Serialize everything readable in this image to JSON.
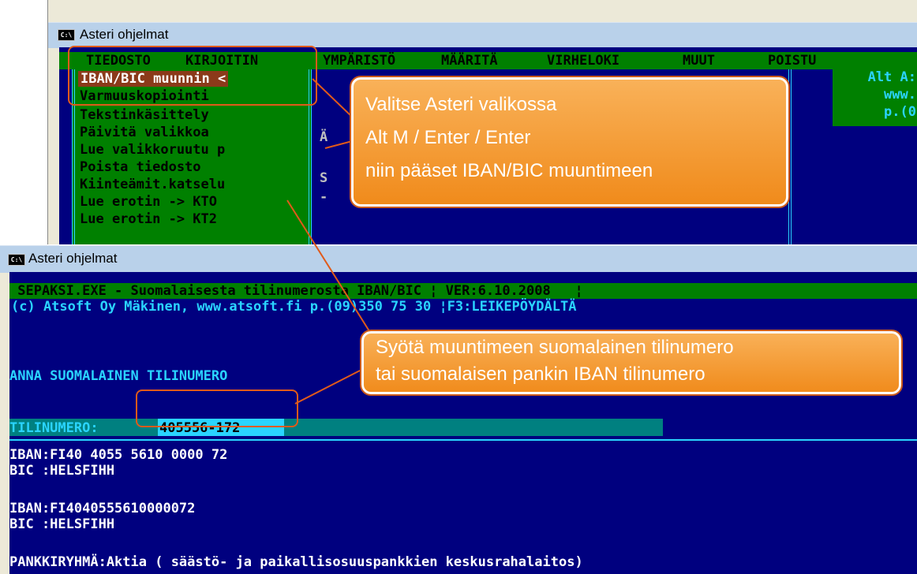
{
  "window_menu": {
    "title": "Asteri ohjelmat",
    "menubar": [
      "TIEDOSTO",
      "KIRJOITIN",
      "YMPÄRISTÖ",
      "MÄÄRITÄ",
      "VIRHELOKI",
      "MUUT",
      "POISTU"
    ],
    "dropdown_items": [
      "IBAN/BIC muunnin <",
      "Varmuuskopiointi",
      "Tekstinkäsittely",
      "Päivitä valikkoa",
      "Lue valikkoruutu p",
      "Poista tiedosto",
      "Kiinteämit.katselu",
      "Lue erotin -> KTO",
      "Lue erotin -> KT2"
    ],
    "side_box_lines": [
      "Alt A:",
      "www.",
      "p.(0"
    ],
    "partial_letters": [
      "Ä",
      "S",
      "-"
    ]
  },
  "window_converter": {
    "title": "Asteri ohjelmat",
    "header_line": " SEPAKSI.EXE - Suomalaisesta tilinumerosta IBAN/BIC ¦ VER:6.10.2008   ¦",
    "copyright_line": "(c) Atsoft Oy Mäkinen, www.atsoft.fi p.(09)350 75 30 ¦F3:LEIKEPÖYDÄLTÄ",
    "prompt": "ANNA SUOMALAINEN TILINUMERO",
    "input_label": "TILINUMERO:",
    "input_value": "405556-172",
    "results": [
      {
        "iban": "IBAN:FI40 4055 5610 0000 72",
        "bic": "BIC :HELSFIHH"
      },
      {
        "iban": "IBAN:FI4040555610000072",
        "bic": "BIC :HELSFIHH"
      }
    ],
    "bank_group": "PANKKIRYHMÄ:Aktia ( säästö- ja paikallisosuuspankkien keskusrahalaitos)"
  },
  "callouts": {
    "menu_hint": [
      "Valitse Asteri valikossa",
      "Alt M / Enter / Enter",
      "niin pääset IBAN/BIC muuntimeen"
    ],
    "input_hint": [
      "Syötä muuntimeen suomalainen tilinumero",
      "tai suomalaisen pankin IBAN tilinumero"
    ]
  },
  "colors": {
    "console_bg": "#00007f",
    "menu_green": "#008000",
    "cyan": "#2ad4ff",
    "selection": "#8b3a1a",
    "callout_orange": "#f08a1a"
  },
  "icons": {
    "window_icon": "console-icon"
  }
}
